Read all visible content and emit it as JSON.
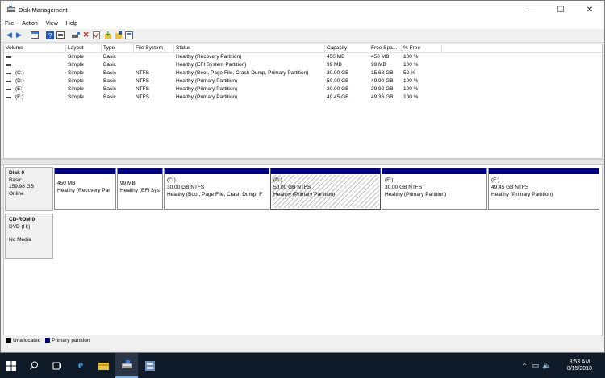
{
  "window": {
    "title": "Disk Management"
  },
  "menu": [
    "File",
    "Action",
    "View",
    "Help"
  ],
  "columns": [
    "Volume",
    "Layout",
    "Type",
    "File System",
    "Status",
    "Capacity",
    "Free Spa...",
    "% Free"
  ],
  "rows": [
    {
      "volume": "",
      "layout": "Simple",
      "type": "Basic",
      "fs": "",
      "status": "Healthy (Recovery Partition)",
      "capacity": "450 MB",
      "free": "450 MB",
      "pct": "100 %"
    },
    {
      "volume": "",
      "layout": "Simple",
      "type": "Basic",
      "fs": "",
      "status": "Healthy (EFI System Partition)",
      "capacity": "99 MB",
      "free": "99 MB",
      "pct": "100 %"
    },
    {
      "volume": "(C:)",
      "layout": "Simple",
      "type": "Basic",
      "fs": "NTFS",
      "status": "Healthy (Boot, Page File, Crash Dump, Primary Partition)",
      "capacity": "30.00 GB",
      "free": "15.68 GB",
      "pct": "52 %"
    },
    {
      "volume": "(D:)",
      "layout": "Simple",
      "type": "Basic",
      "fs": "NTFS",
      "status": "Healthy (Primary Partition)",
      "capacity": "50.00 GB",
      "free": "49.90 GB",
      "pct": "100 %"
    },
    {
      "volume": "(E:)",
      "layout": "Simple",
      "type": "Basic",
      "fs": "NTFS",
      "status": "Healthy (Primary Partition)",
      "capacity": "30.00 GB",
      "free": "29.92 GB",
      "pct": "100 %"
    },
    {
      "volume": "(F:)",
      "layout": "Simple",
      "type": "Basic",
      "fs": "NTFS",
      "status": "Healthy (Primary Partition)",
      "capacity": "49.45 GB",
      "free": "49.36 GB",
      "pct": "100 %"
    }
  ],
  "disk0": {
    "name": "Disk 0",
    "type": "Basic",
    "size": "159.98 GB",
    "status": "Online",
    "partitions": [
      {
        "label": "",
        "size": "450 MB",
        "status": "Healthy (Recovery Par"
      },
      {
        "label": "",
        "size": "99 MB",
        "status": "Healthy (EFI Sys"
      },
      {
        "label": "(C:)",
        "size": "30.00 GB NTFS",
        "status": "Healthy (Boot, Page File, Crash Dump, F"
      },
      {
        "label": "(D:)",
        "size": "50.00 GB NTFS",
        "status": "Healthy (Primary Partition)"
      },
      {
        "label": "(E:)",
        "size": "30.00 GB NTFS",
        "status": "Healthy (Primary Partition)"
      },
      {
        "label": "(F:)",
        "size": "49.45 GB NTFS",
        "status": "Healthy (Primary Partition)"
      }
    ]
  },
  "cdrom0": {
    "name": "CD-ROM 0",
    "type": "DVD (H:)",
    "media": "No Media"
  },
  "legend": {
    "unallocated": "Unallocated",
    "primary": "Primary partition"
  },
  "colors": {
    "primary": "#000080",
    "unallocated": "#000000",
    "taskbar": "#101b2a"
  },
  "clock": {
    "time": "8:53 AM",
    "date": "8/15/2018"
  }
}
